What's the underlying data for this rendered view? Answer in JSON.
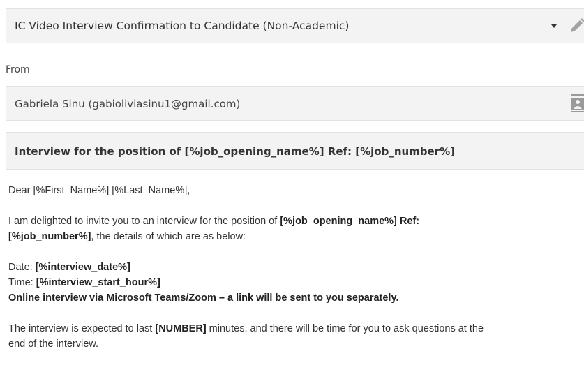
{
  "template": {
    "selected": "IC Video Interview Confirmation to Candidate (Non-Academic)",
    "caret_icon": "chevron-down-icon",
    "edit_icon": "pencil-icon"
  },
  "from": {
    "label": "From",
    "value": "Gabriela Sinu (gabioliviasinu1@gmail.com)",
    "contact_icon": "contact-card-icon"
  },
  "subject": {
    "value": "Interview for the position of [%job_opening_name%] Ref: [%job_number%]"
  },
  "body": {
    "greeting": "Dear [%First_Name%] [%Last_Name%],",
    "p1_a": "I am delighted to invite you to an interview for the position of ",
    "p1_b": "[%job_opening_name%] Ref:",
    "p1_c": "[%job_number%]",
    "p1_d": ", the details of which are as below:",
    "date_label": "Date: ",
    "date_value": "[%interview_date%]",
    "time_label": "Time: ",
    "time_value": "[%interview_start_hour%]",
    "online_line": "Online interview via Microsoft Teams/Zoom – a link will be sent to you separately.",
    "p3_a": "The interview is expected to last ",
    "p3_b": "[NUMBER]",
    "p3_c": " minutes, and there will be time for you to ask questions at the",
    "p3_d": "end of the interview."
  },
  "colors": {
    "field_bg": "#f3f3f3",
    "field_border": "#e2e2e2",
    "icon_gray": "#999999"
  }
}
